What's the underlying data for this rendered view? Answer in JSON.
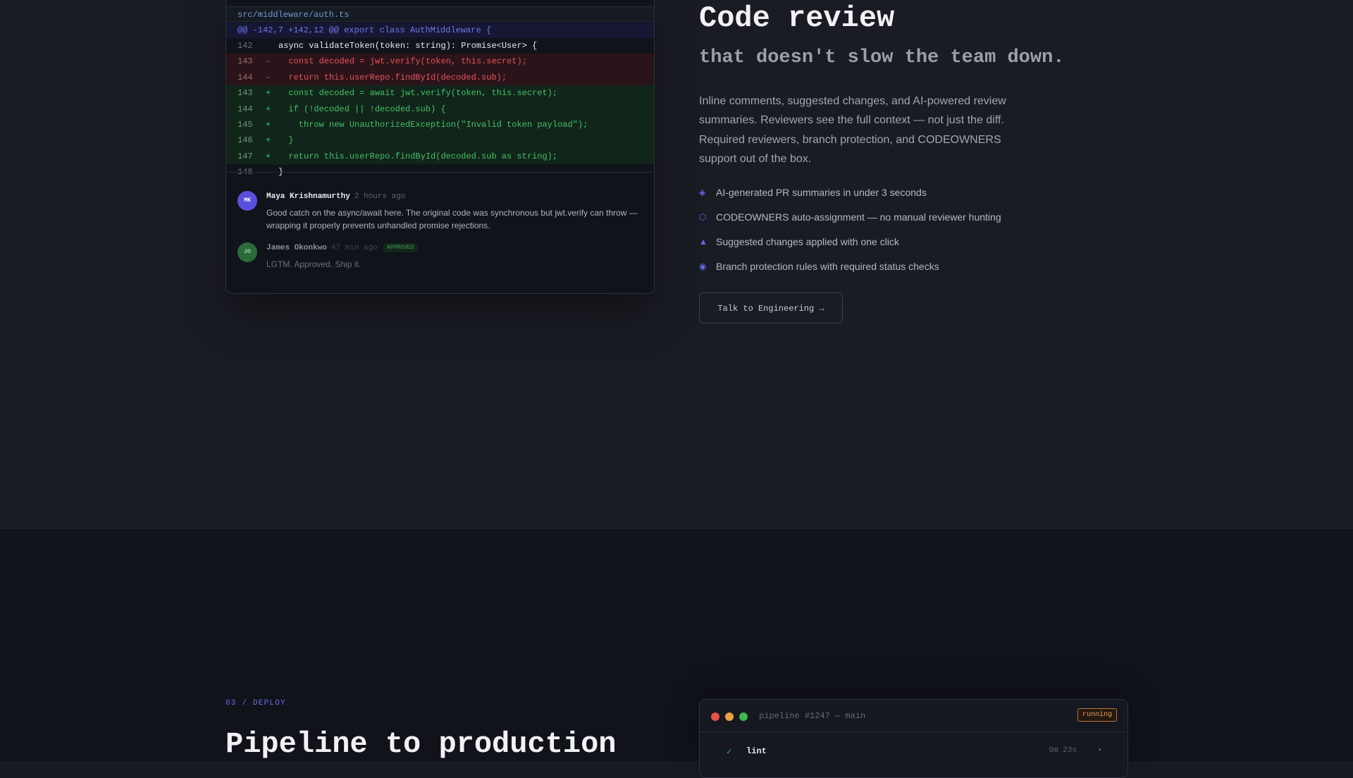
{
  "review_card": {
    "file_path": "src/middleware/auth.ts",
    "hunk_header": "@@ -142,7 +142,12 @@ export class AuthMiddleware {",
    "lines": [
      {
        "num": "142",
        "sign": "",
        "code": "async validateToken(token: string): Promise<User> {",
        "type": "ctx"
      },
      {
        "num": "143",
        "sign": "-",
        "code": "  const decoded = jwt.verify(token, this.secret);",
        "type": "del"
      },
      {
        "num": "144",
        "sign": "-",
        "code": "  return this.userRepo.findById(decoded.sub);",
        "type": "del"
      },
      {
        "num": "143",
        "sign": "+",
        "code": "  const decoded = await jwt.verify(token, this.secret);",
        "type": "add"
      },
      {
        "num": "144",
        "sign": "+",
        "code": "  if (!decoded || !decoded.sub) {",
        "type": "add"
      },
      {
        "num": "145",
        "sign": "+",
        "code": "    throw new UnauthorizedException(\"Invalid token payload\");",
        "type": "add"
      },
      {
        "num": "146",
        "sign": "+",
        "code": "  }",
        "type": "add"
      },
      {
        "num": "147",
        "sign": "+",
        "code": "  return this.userRepo.findById(decoded.sub as string);",
        "type": "add"
      },
      {
        "num": "148",
        "sign": "",
        "code": "}",
        "type": "ctx"
      }
    ],
    "comments": [
      {
        "initials": "MK",
        "author": "Maya Krishnamurthy",
        "time": "2 hours ago",
        "text": "Good catch on the async/await here. The original code was synchronous but jwt.verify can throw — wrapping it properly prevents unhandled promise rejections.",
        "avatar_color": "#5b4fe0"
      },
      {
        "initials": "JO",
        "author": "James Okonkwo",
        "time": "47 min ago",
        "badge": "APPROVED",
        "text": "LGTM. Approved. Ship it.",
        "avatar_color": "#2b6b3a"
      }
    ]
  },
  "code_review": {
    "title": "Code review",
    "subtitle": "that doesn't slow the team down.",
    "description": "Inline comments, suggested changes, and AI-powered review summaries. Reviewers see the full context — not just the diff. Required reviewers, branch protection, and CODEOWNERS support out of the box.",
    "features": [
      {
        "icon": "diamond-icon",
        "glyph": "◈",
        "text": "AI-generated PR summaries in under 3 seconds"
      },
      {
        "icon": "hexagon-icon",
        "glyph": "⬡",
        "text": "CODEOWNERS auto-assignment — no manual reviewer hunting"
      },
      {
        "icon": "triangle-icon",
        "glyph": "▲",
        "text": "Suggested changes applied with one click"
      },
      {
        "icon": "target-icon",
        "glyph": "◉",
        "text": "Branch protection rules with required status checks"
      }
    ],
    "cta_label": "Talk to Engineering →"
  },
  "deploy": {
    "eyebrow": "03 / DEPLOY",
    "title": "Pipeline to production",
    "pipeline": {
      "title": "pipeline #1247 — main",
      "status": "running",
      "window_dots": [
        "#e5534b",
        "#e8a23c",
        "#3fb950"
      ],
      "stages": [
        {
          "icon": "check-icon",
          "glyph": "✓",
          "name": "lint",
          "time": "0m 23s",
          "state": "•"
        }
      ]
    }
  },
  "colors": {
    "accent": "#6669ea",
    "diff_add": "#45c066",
    "diff_del": "#e5535b",
    "background_top": "#191c23",
    "background_bottom": "#10131a"
  }
}
